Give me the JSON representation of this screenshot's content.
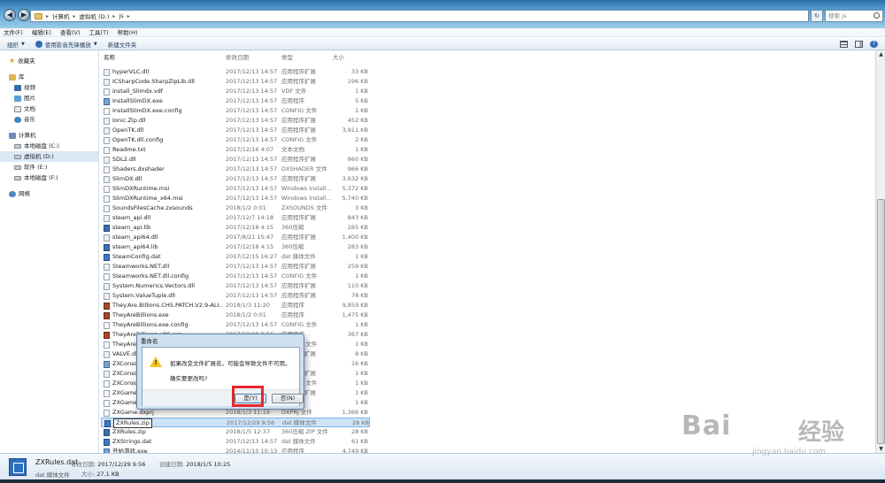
{
  "address": {
    "breadcrumbs": [
      "计算机",
      "虚拟机 (D:)",
      "js"
    ],
    "search_placeholder": "搜索 js"
  },
  "menubar": [
    "文件(F)",
    "编辑(E)",
    "查看(V)",
    "工具(T)",
    "帮助(H)"
  ],
  "toolbar": {
    "organize": "组织",
    "open_with": "使用影音先锋播放",
    "new_folder": "新建文件夹"
  },
  "navpane": {
    "favorites": "收藏夹",
    "libraries": "库",
    "videos": "视频",
    "pictures": "图片",
    "documents": "文档",
    "music": "音乐",
    "computer": "计算机",
    "drive_c": "本地磁盘 (C:)",
    "drive_d": "虚拟机 (D:)",
    "drive_e": "软件 (E:)",
    "drive_f": "本地磁盘 (F:)",
    "network": "网络"
  },
  "columns": {
    "name": "名称",
    "date": "修改日期",
    "type": "类型",
    "size": "大小"
  },
  "files": [
    {
      "name": "hyperVLC.dll",
      "date": "2017/12/13 14:57",
      "type": "应用程序扩展",
      "size": "33 KB",
      "icon": "dll"
    },
    {
      "name": "ICSharpCode.SharpZipLib.dll",
      "date": "2017/12/13 14:57",
      "type": "应用程序扩展",
      "size": "196 KB",
      "icon": "dll"
    },
    {
      "name": "install_Slimdx.vdf",
      "date": "2017/12/13 14:57",
      "type": "VDF 文件",
      "size": "1 KB",
      "icon": "file"
    },
    {
      "name": "InstallSlimDX.exe",
      "date": "2017/12/13 14:57",
      "type": "应用程序",
      "size": "5 KB",
      "icon": "exe"
    },
    {
      "name": "InstallSlimDX.exe.config",
      "date": "2017/12/13 14:57",
      "type": "CONFIG 文件",
      "size": "1 KB",
      "icon": "file"
    },
    {
      "name": "Ionic.Zip.dll",
      "date": "2017/12/13 14:57",
      "type": "应用程序扩展",
      "size": "452 KB",
      "icon": "dll"
    },
    {
      "name": "OpenTK.dll",
      "date": "2017/12/13 14:57",
      "type": "应用程序扩展",
      "size": "3,911 KB",
      "icon": "dll"
    },
    {
      "name": "OpenTK.dll.config",
      "date": "2017/12/13 14:57",
      "type": "CONFIG 文件",
      "size": "2 KB",
      "icon": "file"
    },
    {
      "name": "Readme.txt",
      "date": "2017/12/16 4:07",
      "type": "文本文档",
      "size": "1 KB",
      "icon": "file"
    },
    {
      "name": "SDL2.dll",
      "date": "2017/12/13 14:57",
      "type": "应用程序扩展",
      "size": "860 KB",
      "icon": "dll"
    },
    {
      "name": "Shaders.dxshader",
      "date": "2017/12/13 14:57",
      "type": "DXSHADER 文件",
      "size": "966 KB",
      "icon": "file"
    },
    {
      "name": "SlimDX.dll",
      "date": "2017/12/13 14:57",
      "type": "应用程序扩展",
      "size": "3,632 KB",
      "icon": "dll"
    },
    {
      "name": "SlimDXRuntime.msi",
      "date": "2017/12/13 14:57",
      "type": "Windows Install...",
      "size": "5,372 KB",
      "icon": "file"
    },
    {
      "name": "SlimDXRuntime_x64.msi",
      "date": "2017/12/13 14:57",
      "type": "Windows Install...",
      "size": "5,740 KB",
      "icon": "file"
    },
    {
      "name": "SoundsFilesCache.zxsounds",
      "date": "2018/1/2 0:01",
      "type": "ZXSOUNDS 文件",
      "size": "3 KB",
      "icon": "file"
    },
    {
      "name": "steam_api.dll",
      "date": "2017/12/7 14:18",
      "type": "应用程序扩展",
      "size": "843 KB",
      "icon": "dll"
    },
    {
      "name": "steam_api.lib",
      "date": "2017/12/18 4:15",
      "type": "360压缩",
      "size": "285 KB",
      "icon": "zip"
    },
    {
      "name": "steam_api64.dll",
      "date": "2017/8/21 15:47",
      "type": "应用程序扩展",
      "size": "1,400 KB",
      "icon": "dll"
    },
    {
      "name": "steam_api64.lib",
      "date": "2017/12/18 4:15",
      "type": "360压缩",
      "size": "283 KB",
      "icon": "zip"
    },
    {
      "name": "SteamConfig.dat",
      "date": "2017/12/15 16:27",
      "type": "dat 媒体文件",
      "size": "1 KB",
      "icon": "dat"
    },
    {
      "name": "Steamworks.NET.dll",
      "date": "2017/12/13 14:57",
      "type": "应用程序扩展",
      "size": "259 KB",
      "icon": "dll"
    },
    {
      "name": "Steamworks.NET.dll.config",
      "date": "2017/12/13 14:57",
      "type": "CONFIG 文件",
      "size": "1 KB",
      "icon": "file"
    },
    {
      "name": "System.Numerics.Vectors.dll",
      "date": "2017/12/13 14:57",
      "type": "应用程序扩展",
      "size": "110 KB",
      "icon": "dll"
    },
    {
      "name": "System.ValueTuple.dll",
      "date": "2017/12/13 14:57",
      "type": "应用程序扩展",
      "size": "78 KB",
      "icon": "dll"
    },
    {
      "name": "They.Are.Billions.CHS.PATCH.V2.9-ALI...",
      "date": "2018/1/3 11:20",
      "type": "应用程序",
      "size": "9,859 KB",
      "icon": "game"
    },
    {
      "name": "TheyAreBillions.exe",
      "date": "2018/1/2 0:01",
      "type": "应用程序",
      "size": "1,475 KB",
      "icon": "game"
    },
    {
      "name": "TheyAreBillions.exe.config",
      "date": "2017/12/13 14:57",
      "type": "CONFIG 文件",
      "size": "1 KB",
      "icon": "file"
    },
    {
      "name": "TheyAreBillions_x86.exe",
      "date": "2017/12/29 9:56",
      "type": "应用程序",
      "size": "367 KB",
      "icon": "game"
    },
    {
      "name": "TheyAreBillions_x86.exe.config",
      "date": "2017/12/13 14:57",
      "type": "CONFIG 文件",
      "size": "1 KB",
      "icon": "file"
    },
    {
      "name": "VALVE.dll",
      "date": "2017/12/13 14:57",
      "type": "应用程序扩展",
      "size": "8 KB",
      "icon": "dll"
    },
    {
      "name": "ZXConsole.exe",
      "date": "2017/12/13 14:57",
      "type": "应用程序",
      "size": "16 KB",
      "icon": "exe"
    },
    {
      "name": "ZXConsole.dll",
      "date": "2017/12/13 14:57",
      "type": "应用程序扩展",
      "size": "1 KB",
      "icon": "dll"
    },
    {
      "name": "ZXConsole.dll.config",
      "date": "2017/12/13 14:57",
      "type": "CONFIG 文件",
      "size": "1 KB",
      "icon": "file"
    },
    {
      "name": "ZXGame.dll",
      "date": "2017/12/13 14:57",
      "type": "应用程序扩展",
      "size": "1 KB",
      "icon": "file"
    },
    {
      "name": "ZXGame.exe",
      "date": "2017/12/13 14:57",
      "type": "应用程序",
      "size": "1 KB",
      "icon": "file"
    },
    {
      "name": "ZXGame.dxprj",
      "date": "2018/1/3 11:19",
      "type": "DXPRJ 文件",
      "size": "1,366 KB",
      "icon": "file"
    },
    {
      "name": "ZXRules.zip",
      "date": "2017/12/29 9:56",
      "type": "dat 媒体文件",
      "size": "28 KB",
      "icon": "dat",
      "selected": true
    },
    {
      "name": "ZXRules.zip",
      "date": "2018/1/5 12:37",
      "type": "360压缩 ZIP 文件",
      "size": "28 KB",
      "icon": "zip"
    },
    {
      "name": "ZXStrings.dat",
      "date": "2017/12/13 14:57",
      "type": "dat 媒体文件",
      "size": "61 KB",
      "icon": "dat"
    },
    {
      "name": "开始游戏.exe",
      "date": "2014/11/10 10:13",
      "type": "应用程序",
      "size": "4,749 KB",
      "icon": "exe"
    }
  ],
  "dialog": {
    "title": "重命名",
    "message": "如果改变文件扩展名，可能会导致文件不可用。",
    "question": "确实要更改吗?",
    "yes": "是(Y)",
    "no": "否(N)"
  },
  "details": {
    "name": "ZXRules.dat",
    "type": "dat 媒体文件",
    "modified_label": "修改日期:",
    "modified_value": "2017/12/29 9:56",
    "created_label": "创建日期:",
    "created_value": "2018/1/5 10:25",
    "size_label": "大小:",
    "size_value": "27.1 KB"
  },
  "watermark": {
    "logo": "Bai",
    "cn": "经验",
    "url": "jingyan.baidu.com"
  }
}
